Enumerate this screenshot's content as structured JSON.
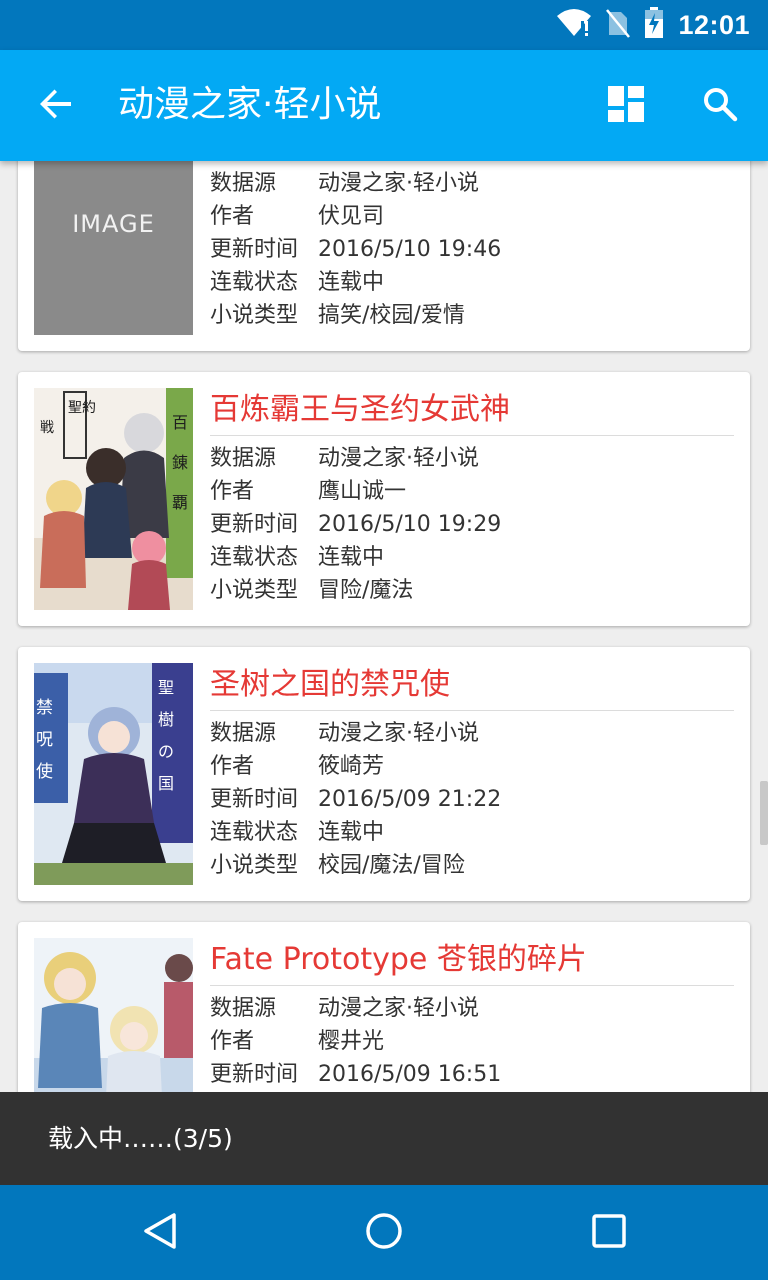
{
  "status_bar": {
    "time": "12:01"
  },
  "app_bar": {
    "title": "动漫之家·轻小说"
  },
  "field_labels": {
    "source": "数据源",
    "author": "作者",
    "updated": "更新时间",
    "status": "连载状态",
    "genre": "小说类型"
  },
  "novels": [
    {
      "title": "",
      "cover_text": "IMAGE",
      "source": "动漫之家·轻小说",
      "author": "伏见司",
      "updated": "2016/5/10 19:46",
      "status": "连载中",
      "genre": "搞笑/校园/爱情"
    },
    {
      "title": "百炼霸王与圣约女武神",
      "source": "动漫之家·轻小说",
      "author": "鹰山诚一",
      "updated": "2016/5/10 19:29",
      "status": "连载中",
      "genre": "冒险/魔法"
    },
    {
      "title": "圣树之国的禁咒使",
      "source": "动漫之家·轻小说",
      "author": "筱崎芳",
      "updated": "2016/5/09 21:22",
      "status": "连载中",
      "genre": "校园/魔法/冒险"
    },
    {
      "title": "Fate Prototype 苍银的碎片",
      "source": "动漫之家·轻小说",
      "author": "樱井光",
      "updated": "2016/5/09 16:51",
      "status": "",
      "genre": ""
    }
  ],
  "snackbar": {
    "text": "载入中……(3/5)"
  },
  "colors": {
    "primary": "#03a9f4",
    "primary_dark": "#0277bd",
    "title_red": "#e53935",
    "snackbar_bg": "#323232"
  },
  "icons": [
    "wifi-icon",
    "no-sim-icon",
    "battery-icon",
    "back-arrow-icon",
    "dashboard-icon",
    "search-icon",
    "nav-back-icon",
    "nav-home-icon",
    "nav-recents-icon"
  ]
}
